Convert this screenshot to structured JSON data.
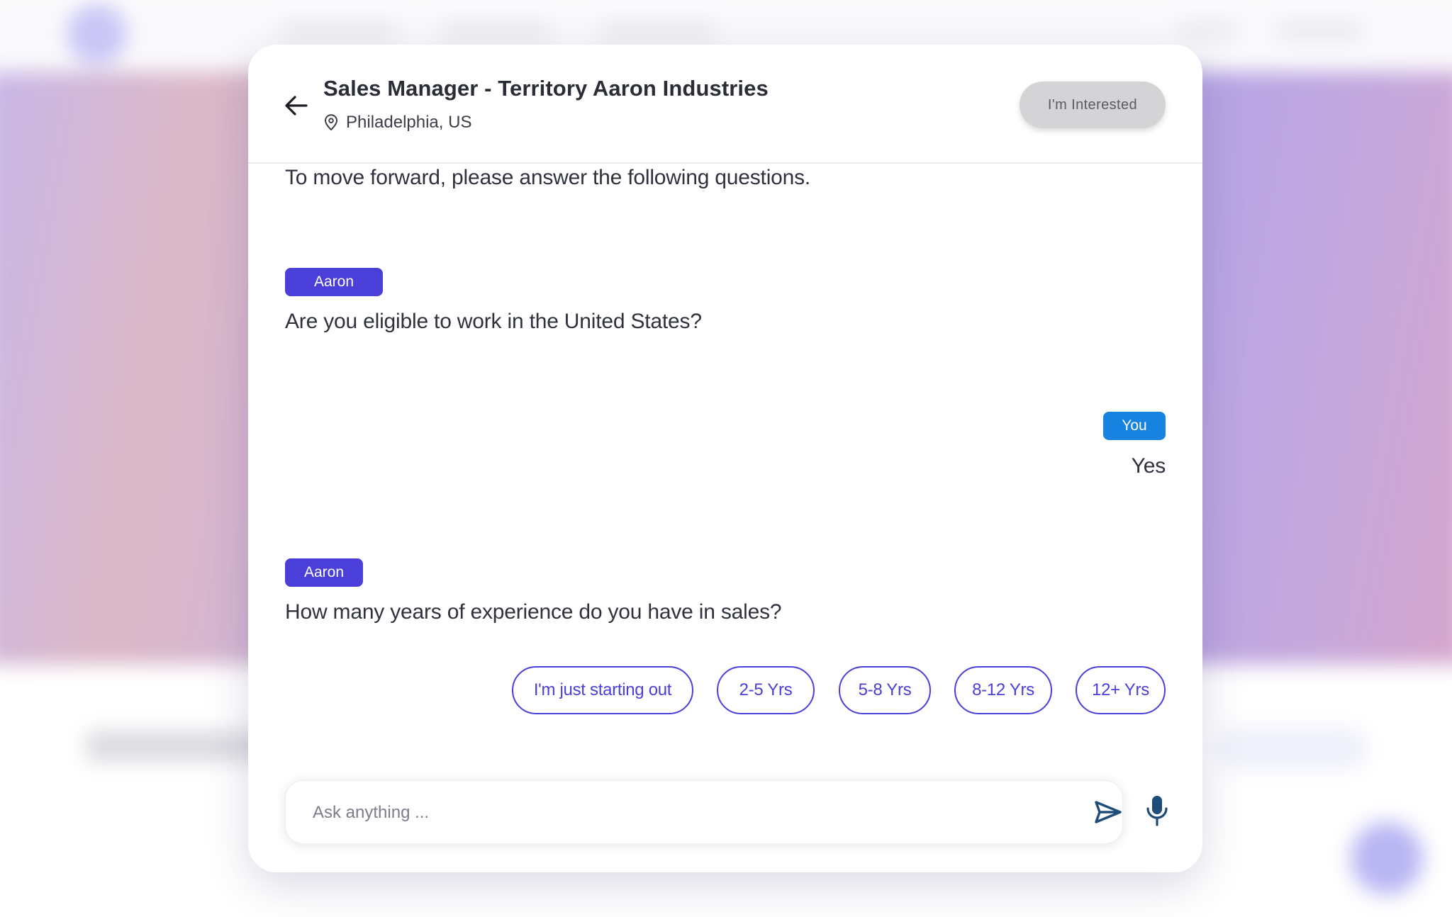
{
  "header": {
    "job_title": "Sales Manager - Territory Aaron Industries",
    "location": "Philadelphia, US",
    "interested_label": "I'm Interested"
  },
  "messages": [
    {
      "sender": "",
      "text": "To move forward, please answer the following questions."
    },
    {
      "sender": "Aaron",
      "text": "Are you eligible to work in the United States?"
    },
    {
      "sender": "You",
      "text": "Yes"
    },
    {
      "sender": "Aaron",
      "text": "How many years of experience do you have in sales?"
    }
  ],
  "quick_replies": [
    "I'm just starting out",
    "2-5 Yrs",
    "5-8 Yrs",
    "8-12 Yrs",
    "12+ Yrs"
  ],
  "input": {
    "placeholder": "Ask anything ..."
  },
  "icons": {
    "back": "arrow-left-icon",
    "location": "map-pin-icon",
    "send": "send-icon",
    "mic": "microphone-icon"
  },
  "colors": {
    "aaron_tag": "#4a3fd8",
    "you_tag": "#1783e0",
    "option_accent": "#4a3fd8",
    "interested_button": "#d4d4d6",
    "send_icon": "#1f4d7a",
    "mic_icon": "#1f4d7a"
  }
}
